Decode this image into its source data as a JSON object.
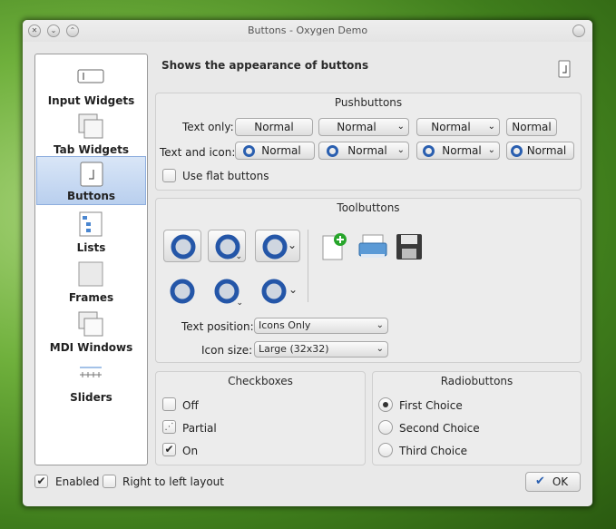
{
  "window": {
    "title": "Buttons - Oxygen Demo"
  },
  "sidebar": {
    "items": [
      {
        "label": "Input Widgets",
        "icon": "input-widgets-icon"
      },
      {
        "label": "Tab Widgets",
        "icon": "tab-widgets-icon"
      },
      {
        "label": "Buttons",
        "icon": "buttons-icon",
        "selected": true
      },
      {
        "label": "Lists",
        "icon": "lists-icon"
      },
      {
        "label": "Frames",
        "icon": "frames-icon"
      },
      {
        "label": "MDI Windows",
        "icon": "mdi-windows-icon"
      },
      {
        "label": "Sliders",
        "icon": "sliders-icon"
      }
    ]
  },
  "heading": "Shows the appearance of buttons",
  "pushbuttons": {
    "title": "Pushbuttons",
    "text_only_label": "Text only:",
    "text_icon_label": "Text and icon:",
    "button_label": "Normal",
    "flat_label": "Use flat buttons"
  },
  "toolbuttons": {
    "title": "Toolbuttons",
    "text_position_label": "Text position:",
    "text_position_value": "Icons Only",
    "icon_size_label": "Icon size:",
    "icon_size_value": "Large (32x32)"
  },
  "checkboxes": {
    "title": "Checkboxes",
    "items": [
      {
        "label": "Off",
        "state": "off"
      },
      {
        "label": "Partial",
        "state": "partial"
      },
      {
        "label": "On",
        "state": "on"
      }
    ]
  },
  "radiobuttons": {
    "title": "Radiobuttons",
    "items": [
      {
        "label": "First Choice",
        "checked": true
      },
      {
        "label": "Second Choice",
        "checked": false
      },
      {
        "label": "Third Choice",
        "checked": false
      }
    ]
  },
  "footer": {
    "enabled_label": "Enabled",
    "rtl_label": "Right to left layout",
    "ok_label": "OK"
  }
}
